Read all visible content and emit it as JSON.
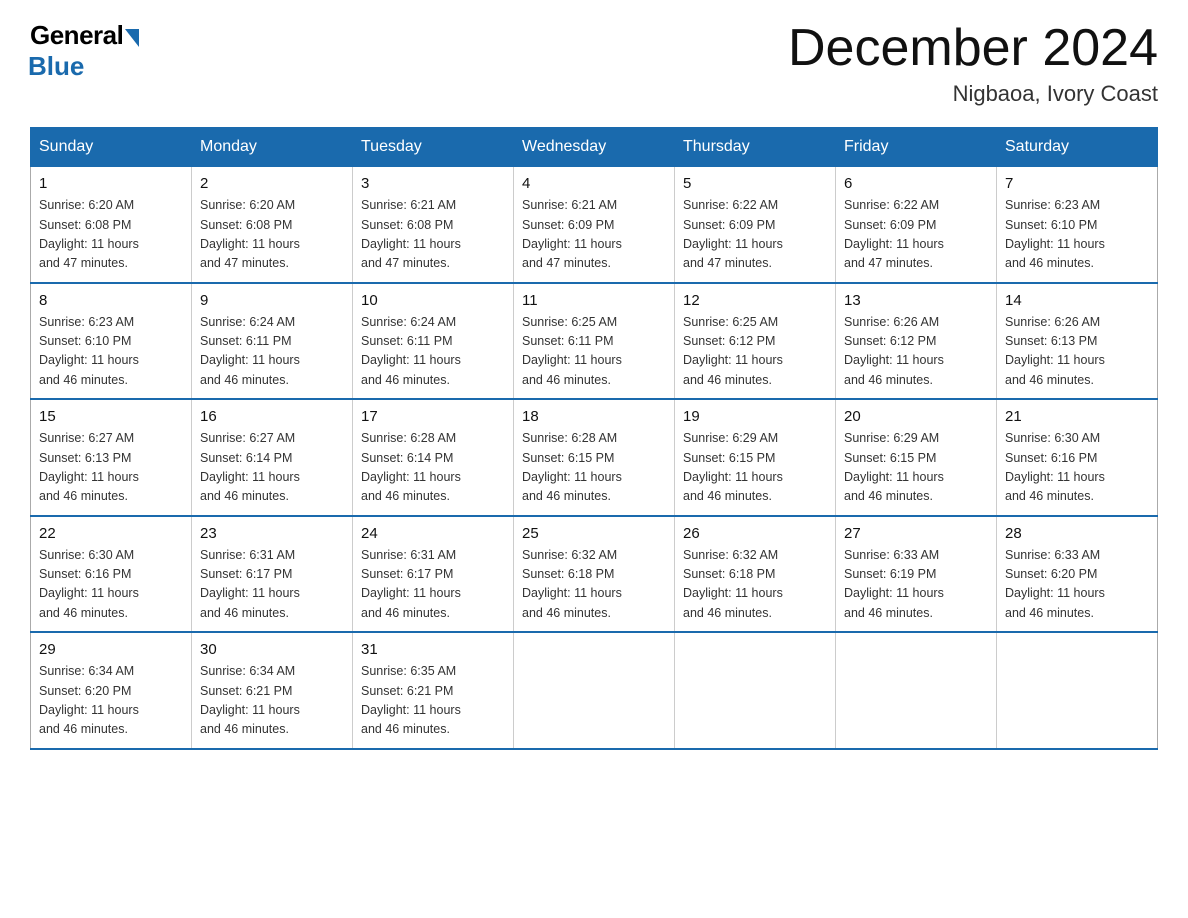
{
  "logo": {
    "general": "General",
    "blue": "Blue"
  },
  "title": "December 2024",
  "location": "Nigbaoa, Ivory Coast",
  "days_of_week": [
    "Sunday",
    "Monday",
    "Tuesday",
    "Wednesday",
    "Thursday",
    "Friday",
    "Saturday"
  ],
  "weeks": [
    [
      {
        "day": "1",
        "sunrise": "6:20 AM",
        "sunset": "6:08 PM",
        "daylight": "11 hours and 47 minutes."
      },
      {
        "day": "2",
        "sunrise": "6:20 AM",
        "sunset": "6:08 PM",
        "daylight": "11 hours and 47 minutes."
      },
      {
        "day": "3",
        "sunrise": "6:21 AM",
        "sunset": "6:08 PM",
        "daylight": "11 hours and 47 minutes."
      },
      {
        "day": "4",
        "sunrise": "6:21 AM",
        "sunset": "6:09 PM",
        "daylight": "11 hours and 47 minutes."
      },
      {
        "day": "5",
        "sunrise": "6:22 AM",
        "sunset": "6:09 PM",
        "daylight": "11 hours and 47 minutes."
      },
      {
        "day": "6",
        "sunrise": "6:22 AM",
        "sunset": "6:09 PM",
        "daylight": "11 hours and 47 minutes."
      },
      {
        "day": "7",
        "sunrise": "6:23 AM",
        "sunset": "6:10 PM",
        "daylight": "11 hours and 46 minutes."
      }
    ],
    [
      {
        "day": "8",
        "sunrise": "6:23 AM",
        "sunset": "6:10 PM",
        "daylight": "11 hours and 46 minutes."
      },
      {
        "day": "9",
        "sunrise": "6:24 AM",
        "sunset": "6:11 PM",
        "daylight": "11 hours and 46 minutes."
      },
      {
        "day": "10",
        "sunrise": "6:24 AM",
        "sunset": "6:11 PM",
        "daylight": "11 hours and 46 minutes."
      },
      {
        "day": "11",
        "sunrise": "6:25 AM",
        "sunset": "6:11 PM",
        "daylight": "11 hours and 46 minutes."
      },
      {
        "day": "12",
        "sunrise": "6:25 AM",
        "sunset": "6:12 PM",
        "daylight": "11 hours and 46 minutes."
      },
      {
        "day": "13",
        "sunrise": "6:26 AM",
        "sunset": "6:12 PM",
        "daylight": "11 hours and 46 minutes."
      },
      {
        "day": "14",
        "sunrise": "6:26 AM",
        "sunset": "6:13 PM",
        "daylight": "11 hours and 46 minutes."
      }
    ],
    [
      {
        "day": "15",
        "sunrise": "6:27 AM",
        "sunset": "6:13 PM",
        "daylight": "11 hours and 46 minutes."
      },
      {
        "day": "16",
        "sunrise": "6:27 AM",
        "sunset": "6:14 PM",
        "daylight": "11 hours and 46 minutes."
      },
      {
        "day": "17",
        "sunrise": "6:28 AM",
        "sunset": "6:14 PM",
        "daylight": "11 hours and 46 minutes."
      },
      {
        "day": "18",
        "sunrise": "6:28 AM",
        "sunset": "6:15 PM",
        "daylight": "11 hours and 46 minutes."
      },
      {
        "day": "19",
        "sunrise": "6:29 AM",
        "sunset": "6:15 PM",
        "daylight": "11 hours and 46 minutes."
      },
      {
        "day": "20",
        "sunrise": "6:29 AM",
        "sunset": "6:15 PM",
        "daylight": "11 hours and 46 minutes."
      },
      {
        "day": "21",
        "sunrise": "6:30 AM",
        "sunset": "6:16 PM",
        "daylight": "11 hours and 46 minutes."
      }
    ],
    [
      {
        "day": "22",
        "sunrise": "6:30 AM",
        "sunset": "6:16 PM",
        "daylight": "11 hours and 46 minutes."
      },
      {
        "day": "23",
        "sunrise": "6:31 AM",
        "sunset": "6:17 PM",
        "daylight": "11 hours and 46 minutes."
      },
      {
        "day": "24",
        "sunrise": "6:31 AM",
        "sunset": "6:17 PM",
        "daylight": "11 hours and 46 minutes."
      },
      {
        "day": "25",
        "sunrise": "6:32 AM",
        "sunset": "6:18 PM",
        "daylight": "11 hours and 46 minutes."
      },
      {
        "day": "26",
        "sunrise": "6:32 AM",
        "sunset": "6:18 PM",
        "daylight": "11 hours and 46 minutes."
      },
      {
        "day": "27",
        "sunrise": "6:33 AM",
        "sunset": "6:19 PM",
        "daylight": "11 hours and 46 minutes."
      },
      {
        "day": "28",
        "sunrise": "6:33 AM",
        "sunset": "6:20 PM",
        "daylight": "11 hours and 46 minutes."
      }
    ],
    [
      {
        "day": "29",
        "sunrise": "6:34 AM",
        "sunset": "6:20 PM",
        "daylight": "11 hours and 46 minutes."
      },
      {
        "day": "30",
        "sunrise": "6:34 AM",
        "sunset": "6:21 PM",
        "daylight": "11 hours and 46 minutes."
      },
      {
        "day": "31",
        "sunrise": "6:35 AM",
        "sunset": "6:21 PM",
        "daylight": "11 hours and 46 minutes."
      },
      null,
      null,
      null,
      null
    ]
  ],
  "labels": {
    "sunrise": "Sunrise:",
    "sunset": "Sunset:",
    "daylight": "Daylight:"
  }
}
